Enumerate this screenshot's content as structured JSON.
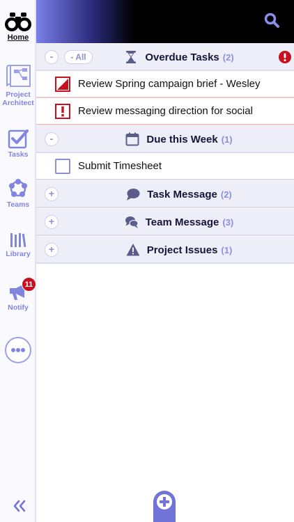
{
  "sidebar": {
    "home_label": "Home",
    "project_label_1": "Project",
    "project_label_2": "Architect",
    "tasks_label": "Tasks",
    "teams_label": "Teams",
    "library_label": "Library",
    "notify_label": "Notify",
    "notify_badge": "11"
  },
  "colors": {
    "accent": "#8085e0",
    "header_black": "#000000",
    "overdue_red": "#c8101f",
    "section_bg": "#eeeef9"
  },
  "sections": {
    "overdue": {
      "toggle": "-",
      "all_label": "- All",
      "title": "Overdue Tasks",
      "count": "(2)"
    },
    "due_week": {
      "toggle": "-",
      "title": "Due this Week",
      "count": "(1)"
    },
    "task_message": {
      "toggle": "+",
      "title": "Task Message",
      "count": "(2)"
    },
    "team_message": {
      "toggle": "+",
      "title": "Team Message",
      "count": "(3)"
    },
    "project_issues": {
      "toggle": "+",
      "title": "Project Issues",
      "count": "(1)"
    }
  },
  "tasks": {
    "overdue": [
      {
        "text": "Review Spring campaign brief - Wesley",
        "icon": "corner-flag-icon"
      },
      {
        "text": "Review messaging direction for social",
        "icon": "exclamation-box-icon"
      }
    ],
    "due_week": [
      {
        "text": "Submit Timesheet",
        "icon": "empty-checkbox-icon"
      }
    ]
  }
}
